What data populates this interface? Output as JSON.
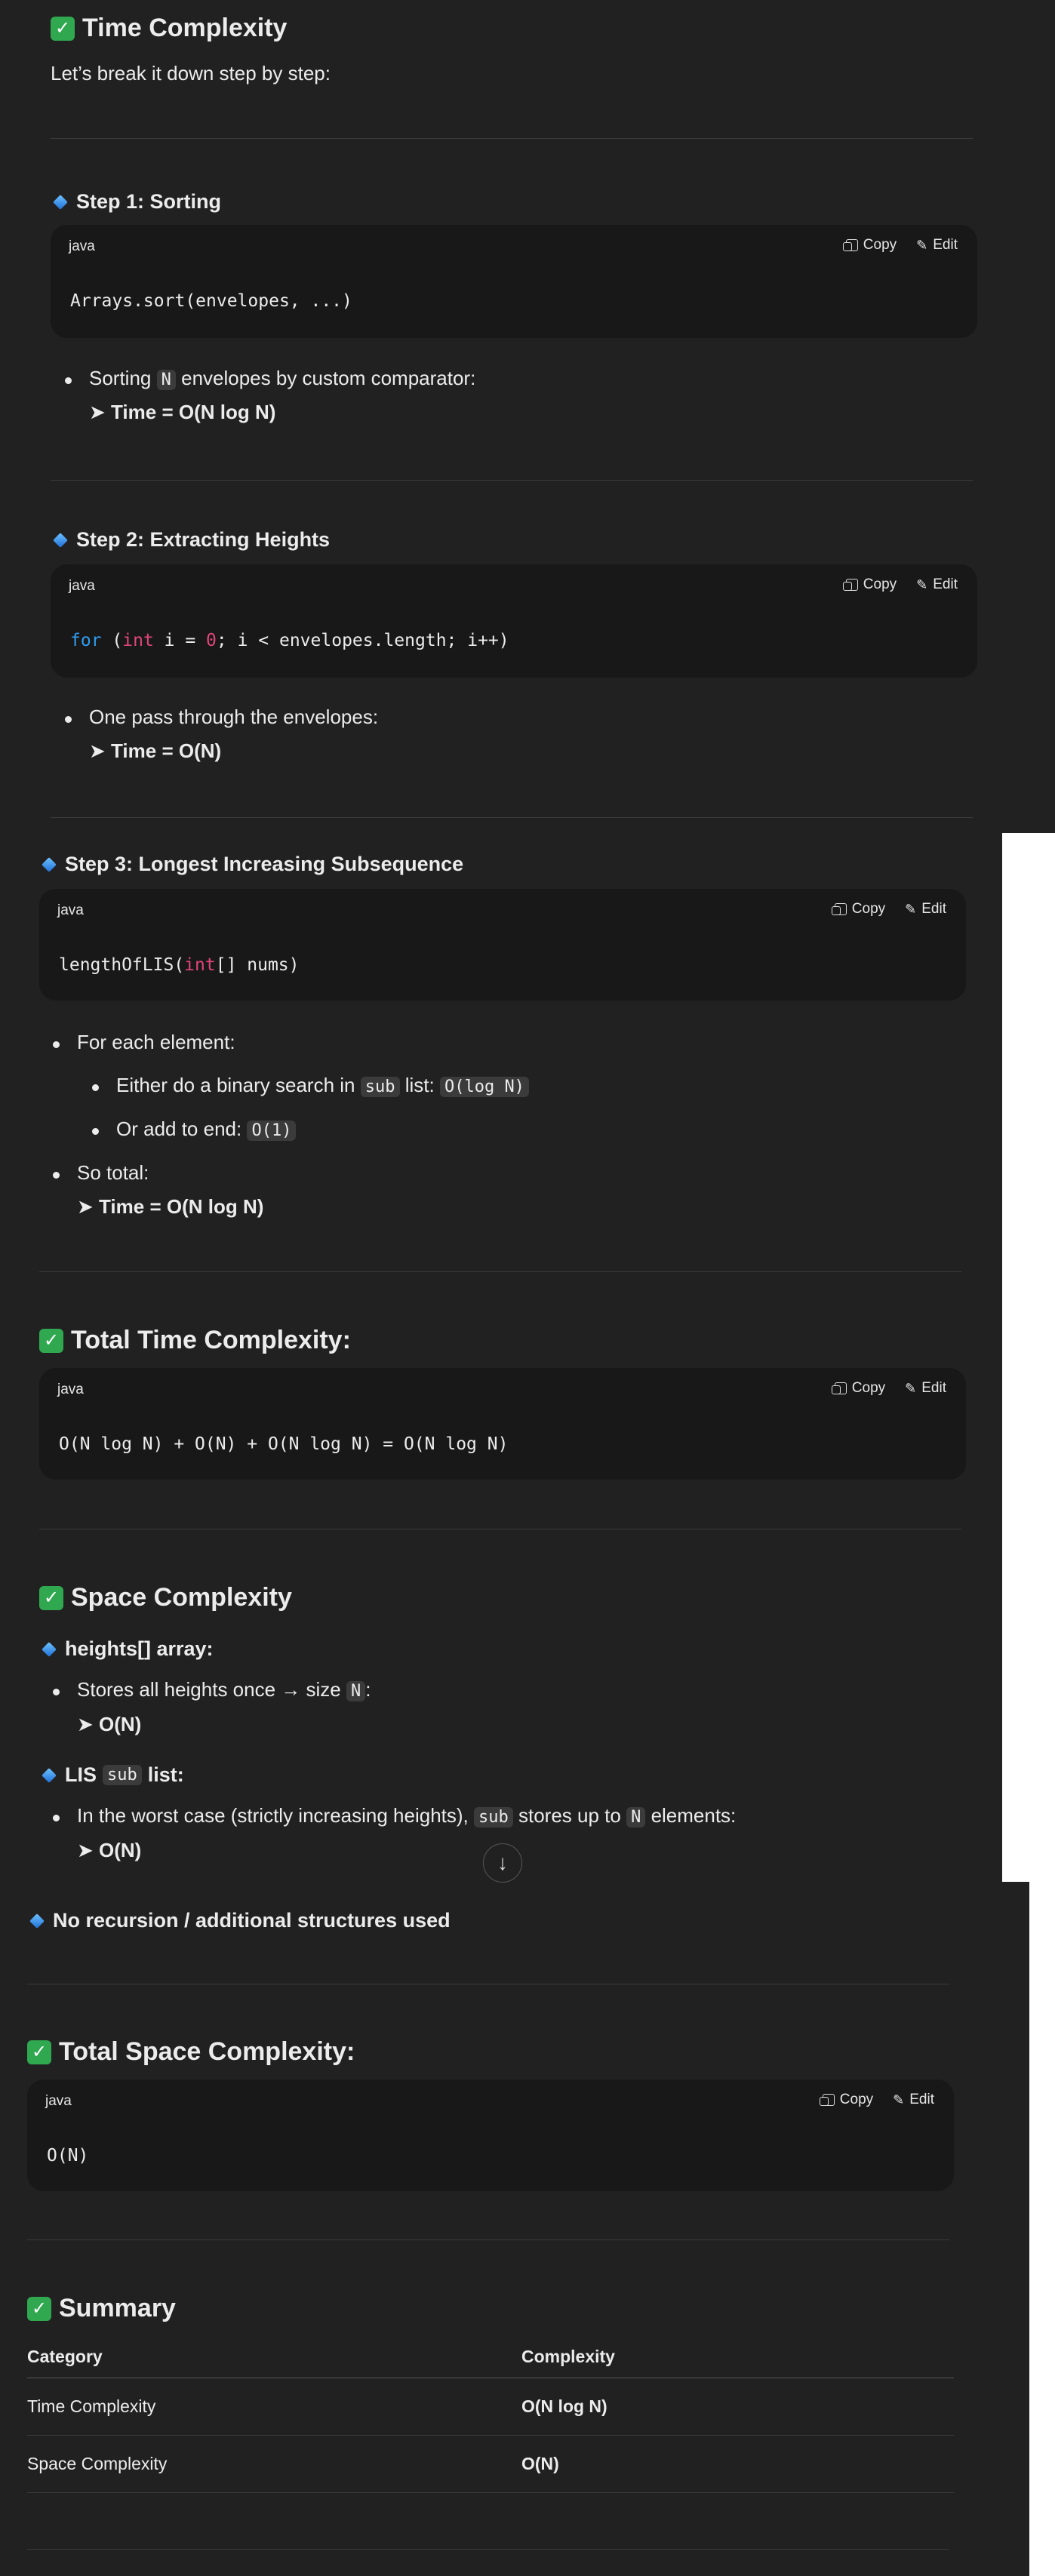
{
  "sections": {
    "time_title": "Time Complexity",
    "intro": "Let’s break it down step by step:",
    "step1_title": "Step 1: Sorting",
    "step1_code": "Arrays.sort(envelopes, ...)",
    "step1_b1_pre": "Sorting",
    "step1_b1_code": "N",
    "step1_b1_post": "envelopes by custom comparator:",
    "step1_result": "➤ Time = O(N log N)",
    "step2_title": "Step 2: Extracting Heights",
    "step2_b1": "One pass through the envelopes:",
    "step2_result": "➤ Time = O(N)",
    "step3_title": "Step 3: Longest Increasing Subsequence",
    "step3_b1": "For each element:",
    "step3_sb1_pre": "Either do a binary search in",
    "step3_sb1_code1": "sub",
    "step3_sb1_mid": "list:",
    "step3_sb1_code2": "O(log N)",
    "step3_sb2_pre": "Or add to end:",
    "step3_sb2_code": "O(1)",
    "step3_b2": "So total:",
    "step3_result": "➤ Time = O(N log N)",
    "total_time_title": "Total Time Complexity:",
    "total_time_code": "O(N log N) + O(N) + O(N log N) = O(N log N)",
    "space_title": "Space Complexity",
    "heights_title": "heights[] array:",
    "heights_b1_pre": "Stores all heights once → size",
    "heights_b1_code": "N",
    "heights_b1_post": ":",
    "heights_result": "➤ O(N)",
    "lis_title_pre": "LIS",
    "lis_title_code": "sub",
    "lis_title_post": "list:",
    "lis_b1_pre": "In the worst case (strictly increasing heights),",
    "lis_b1_code1": "sub",
    "lis_b1_mid": "stores up to",
    "lis_b1_code2": "N",
    "lis_b1_post": "elements:",
    "lis_result": "➤ O(N)",
    "norec_title": "No recursion / additional structures used",
    "total_space_title": "Total Space Complexity:",
    "total_space_code": "O(N)",
    "summary_title": "Summary"
  },
  "code": {
    "lang": "java",
    "copy": "Copy",
    "edit": "Edit",
    "step2_kw": "for",
    "step2_p1": " (",
    "step2_ty": "int",
    "step2_p2": " i = ",
    "step2_num": "0",
    "step2_p3": "; i < envelopes.length; i++)",
    "step3_p1": "lengthOfLIS(",
    "step3_ty": "int",
    "step3_p2": "[] nums)"
  },
  "summary_table": {
    "headers": [
      "Category",
      "Complexity"
    ],
    "rows": [
      [
        "Time Complexity",
        "O(N log N)"
      ],
      [
        "Space Complexity",
        "O(N)"
      ]
    ]
  },
  "icons": {
    "check": "✓",
    "down_arrow": "↓",
    "edit": "✎"
  },
  "colors": {
    "background": "#212121",
    "code_bg": "#181818",
    "keyword": "#2f9cf0",
    "type": "#e0457b",
    "check_green": "#2fa84f"
  }
}
